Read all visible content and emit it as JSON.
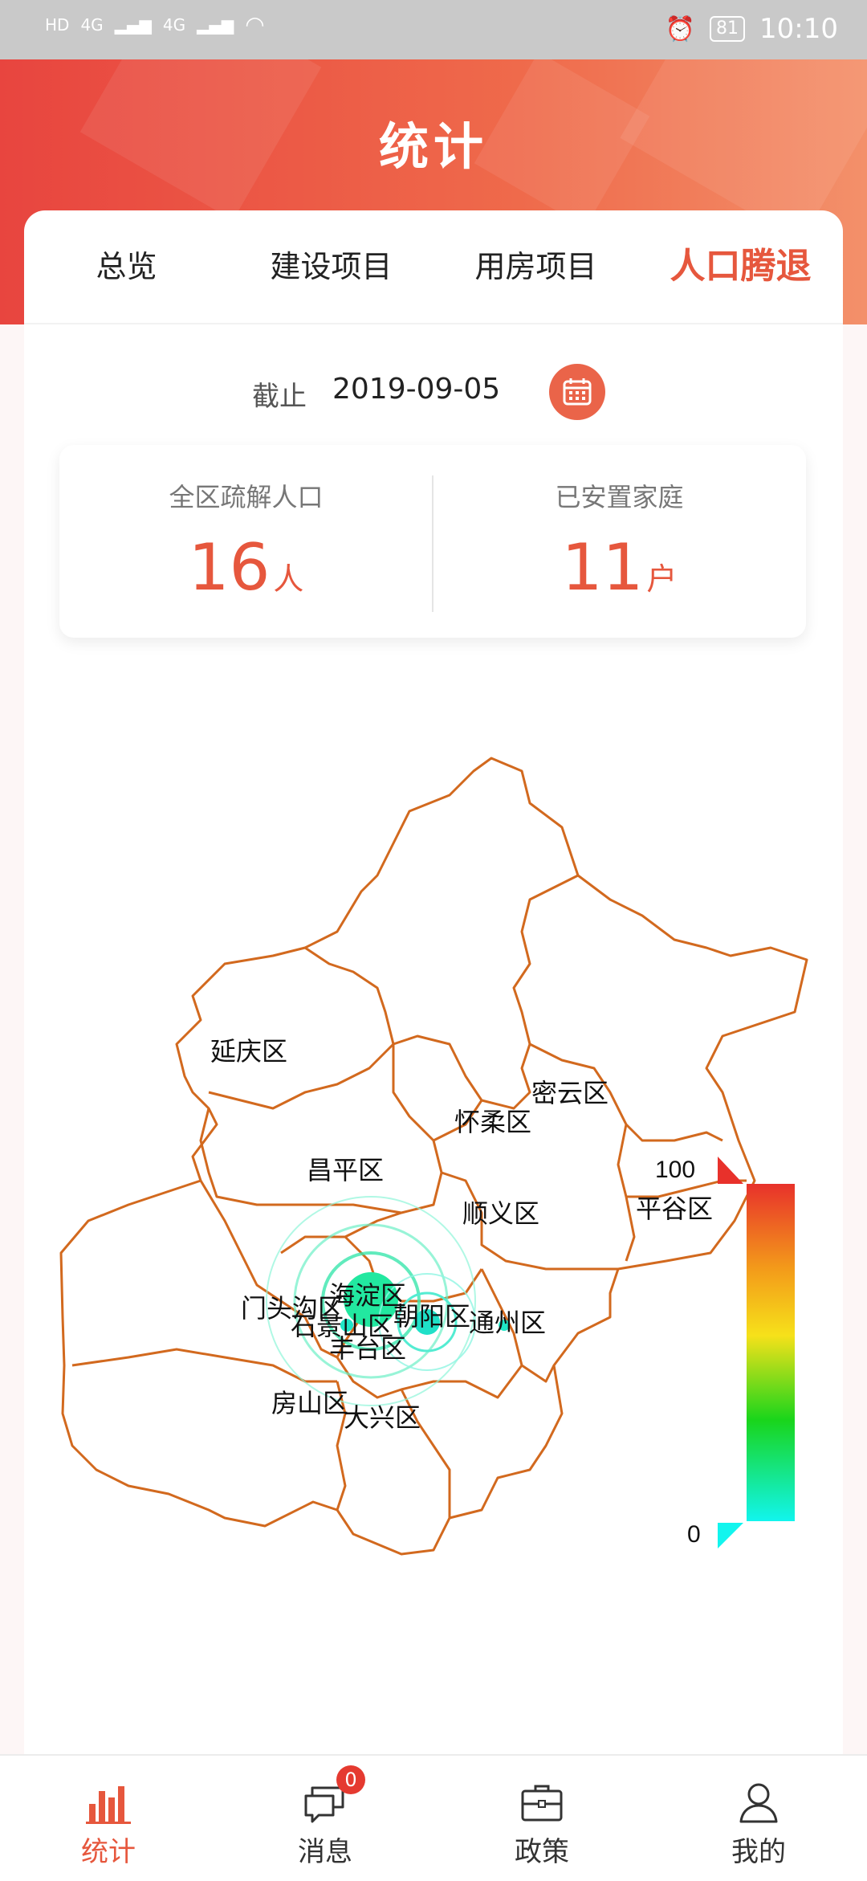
{
  "status_bar": {
    "left": [
      "HD",
      "4G",
      "4G"
    ],
    "battery": "81",
    "time": "10:10"
  },
  "header": {
    "title": "统计"
  },
  "tabs": [
    {
      "label": "总览",
      "active": false
    },
    {
      "label": "建设项目",
      "active": false
    },
    {
      "label": "用房项目",
      "active": false
    },
    {
      "label": "人口腾退",
      "active": true
    }
  ],
  "date": {
    "label": "截止",
    "value": "2019-09-05",
    "icon": "calendar-icon"
  },
  "stats": [
    {
      "label": "全区疏解人口",
      "value": "16",
      "unit": "人"
    },
    {
      "label": "已安置家庭",
      "value": "11",
      "unit": "户"
    }
  ],
  "map": {
    "districts": [
      "延庆区",
      "密云区",
      "怀柔区",
      "昌平区",
      "顺义区",
      "平谷区",
      "门头沟区",
      "石景山区",
      "海淀区",
      "朝阳区",
      "丰台区",
      "通州区",
      "房山区",
      "大兴区"
    ],
    "legend": {
      "max": "100",
      "min": "0",
      "gradient": [
        "#e8312b",
        "#f39a1a",
        "#f6e11a",
        "#19d51b",
        "#12f5ee"
      ]
    },
    "border_color": "#d2691e"
  },
  "bottom_nav": [
    {
      "label": "统计",
      "icon": "bar-chart-icon",
      "active": true
    },
    {
      "label": "消息",
      "icon": "chat-bubbles-icon",
      "active": false,
      "badge": "0"
    },
    {
      "label": "政策",
      "icon": "briefcase-icon",
      "active": false
    },
    {
      "label": "我的",
      "icon": "user-icon",
      "active": false
    }
  ]
}
